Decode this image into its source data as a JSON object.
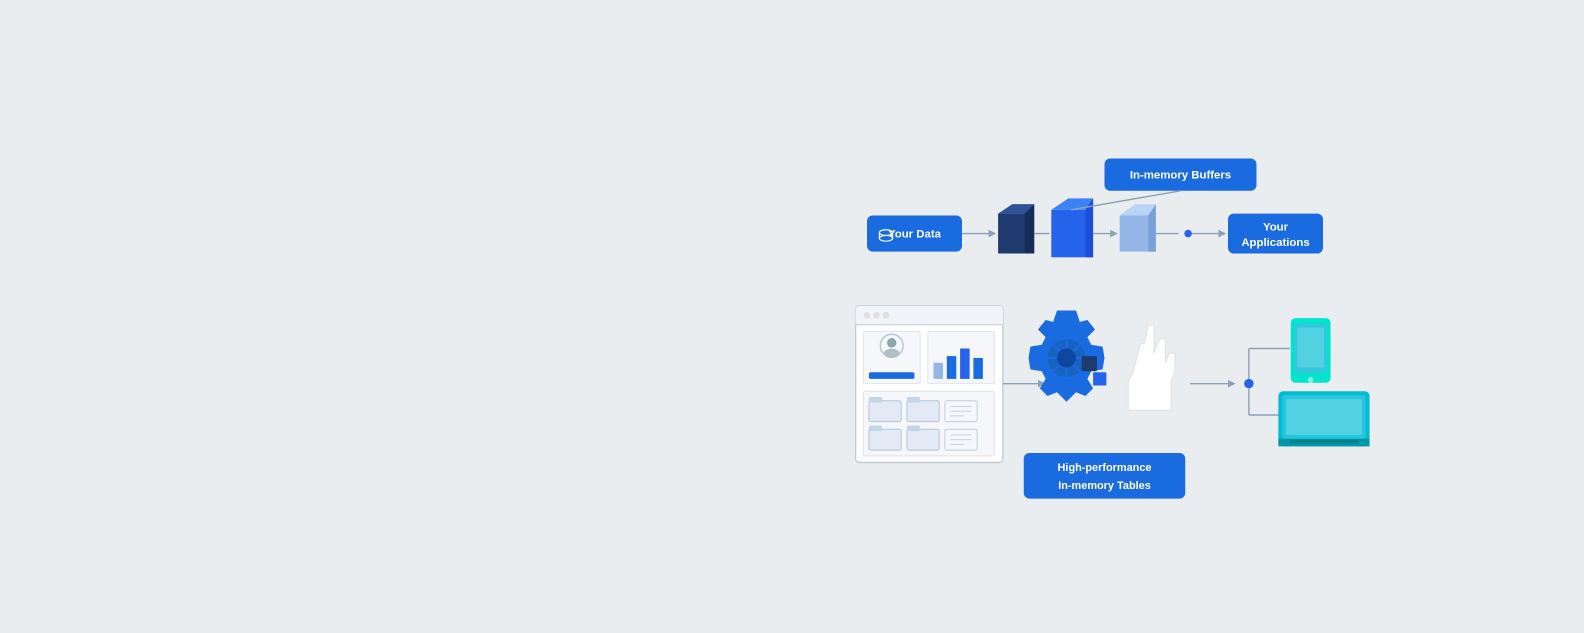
{
  "diagram": {
    "yourData": {
      "label": "Your Data",
      "icon": "database-icon"
    },
    "yourApplications": {
      "label": "Your Applications"
    },
    "inMemoryBuffers": {
      "label": "In-memory Buffers"
    },
    "highPerformance": {
      "line1": "High-performance",
      "line2": "In-memory Tables",
      "combined": "High-performance\nIn-memory Tables"
    }
  },
  "colors": {
    "blue": "#1a6be0",
    "darkBlue": "#1e3a6e",
    "lightBlue": "#93b5e8",
    "fadedBlue": "#b0c8e8",
    "teal": "#00bcd4",
    "arrowGray": "#8ca0b8",
    "bg": "#eaedf0"
  }
}
